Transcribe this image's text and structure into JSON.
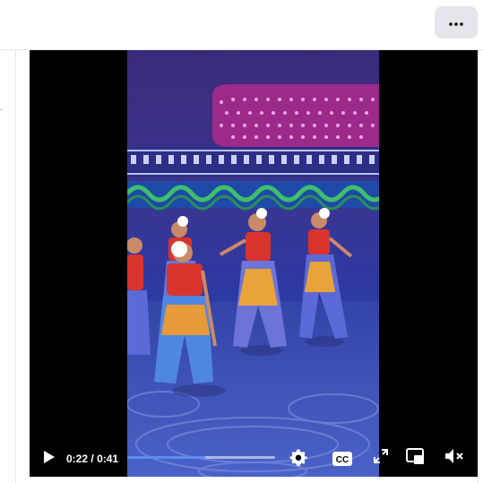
{
  "header": {
    "more_button": "more-options"
  },
  "video": {
    "current_time": "0:22",
    "separator": "/",
    "duration": "0:41",
    "progress": 0.53,
    "progress_color": "#5b8def",
    "muted": true,
    "captions": "CC"
  },
  "icons": {
    "more": "ellipsis-icon",
    "play": "play-icon",
    "settings": "gear-icon",
    "captions": "closed-captions-icon",
    "fullscreen": "expand-icon",
    "pip": "picture-in-picture-icon",
    "volume": "volume-muted-icon"
  }
}
